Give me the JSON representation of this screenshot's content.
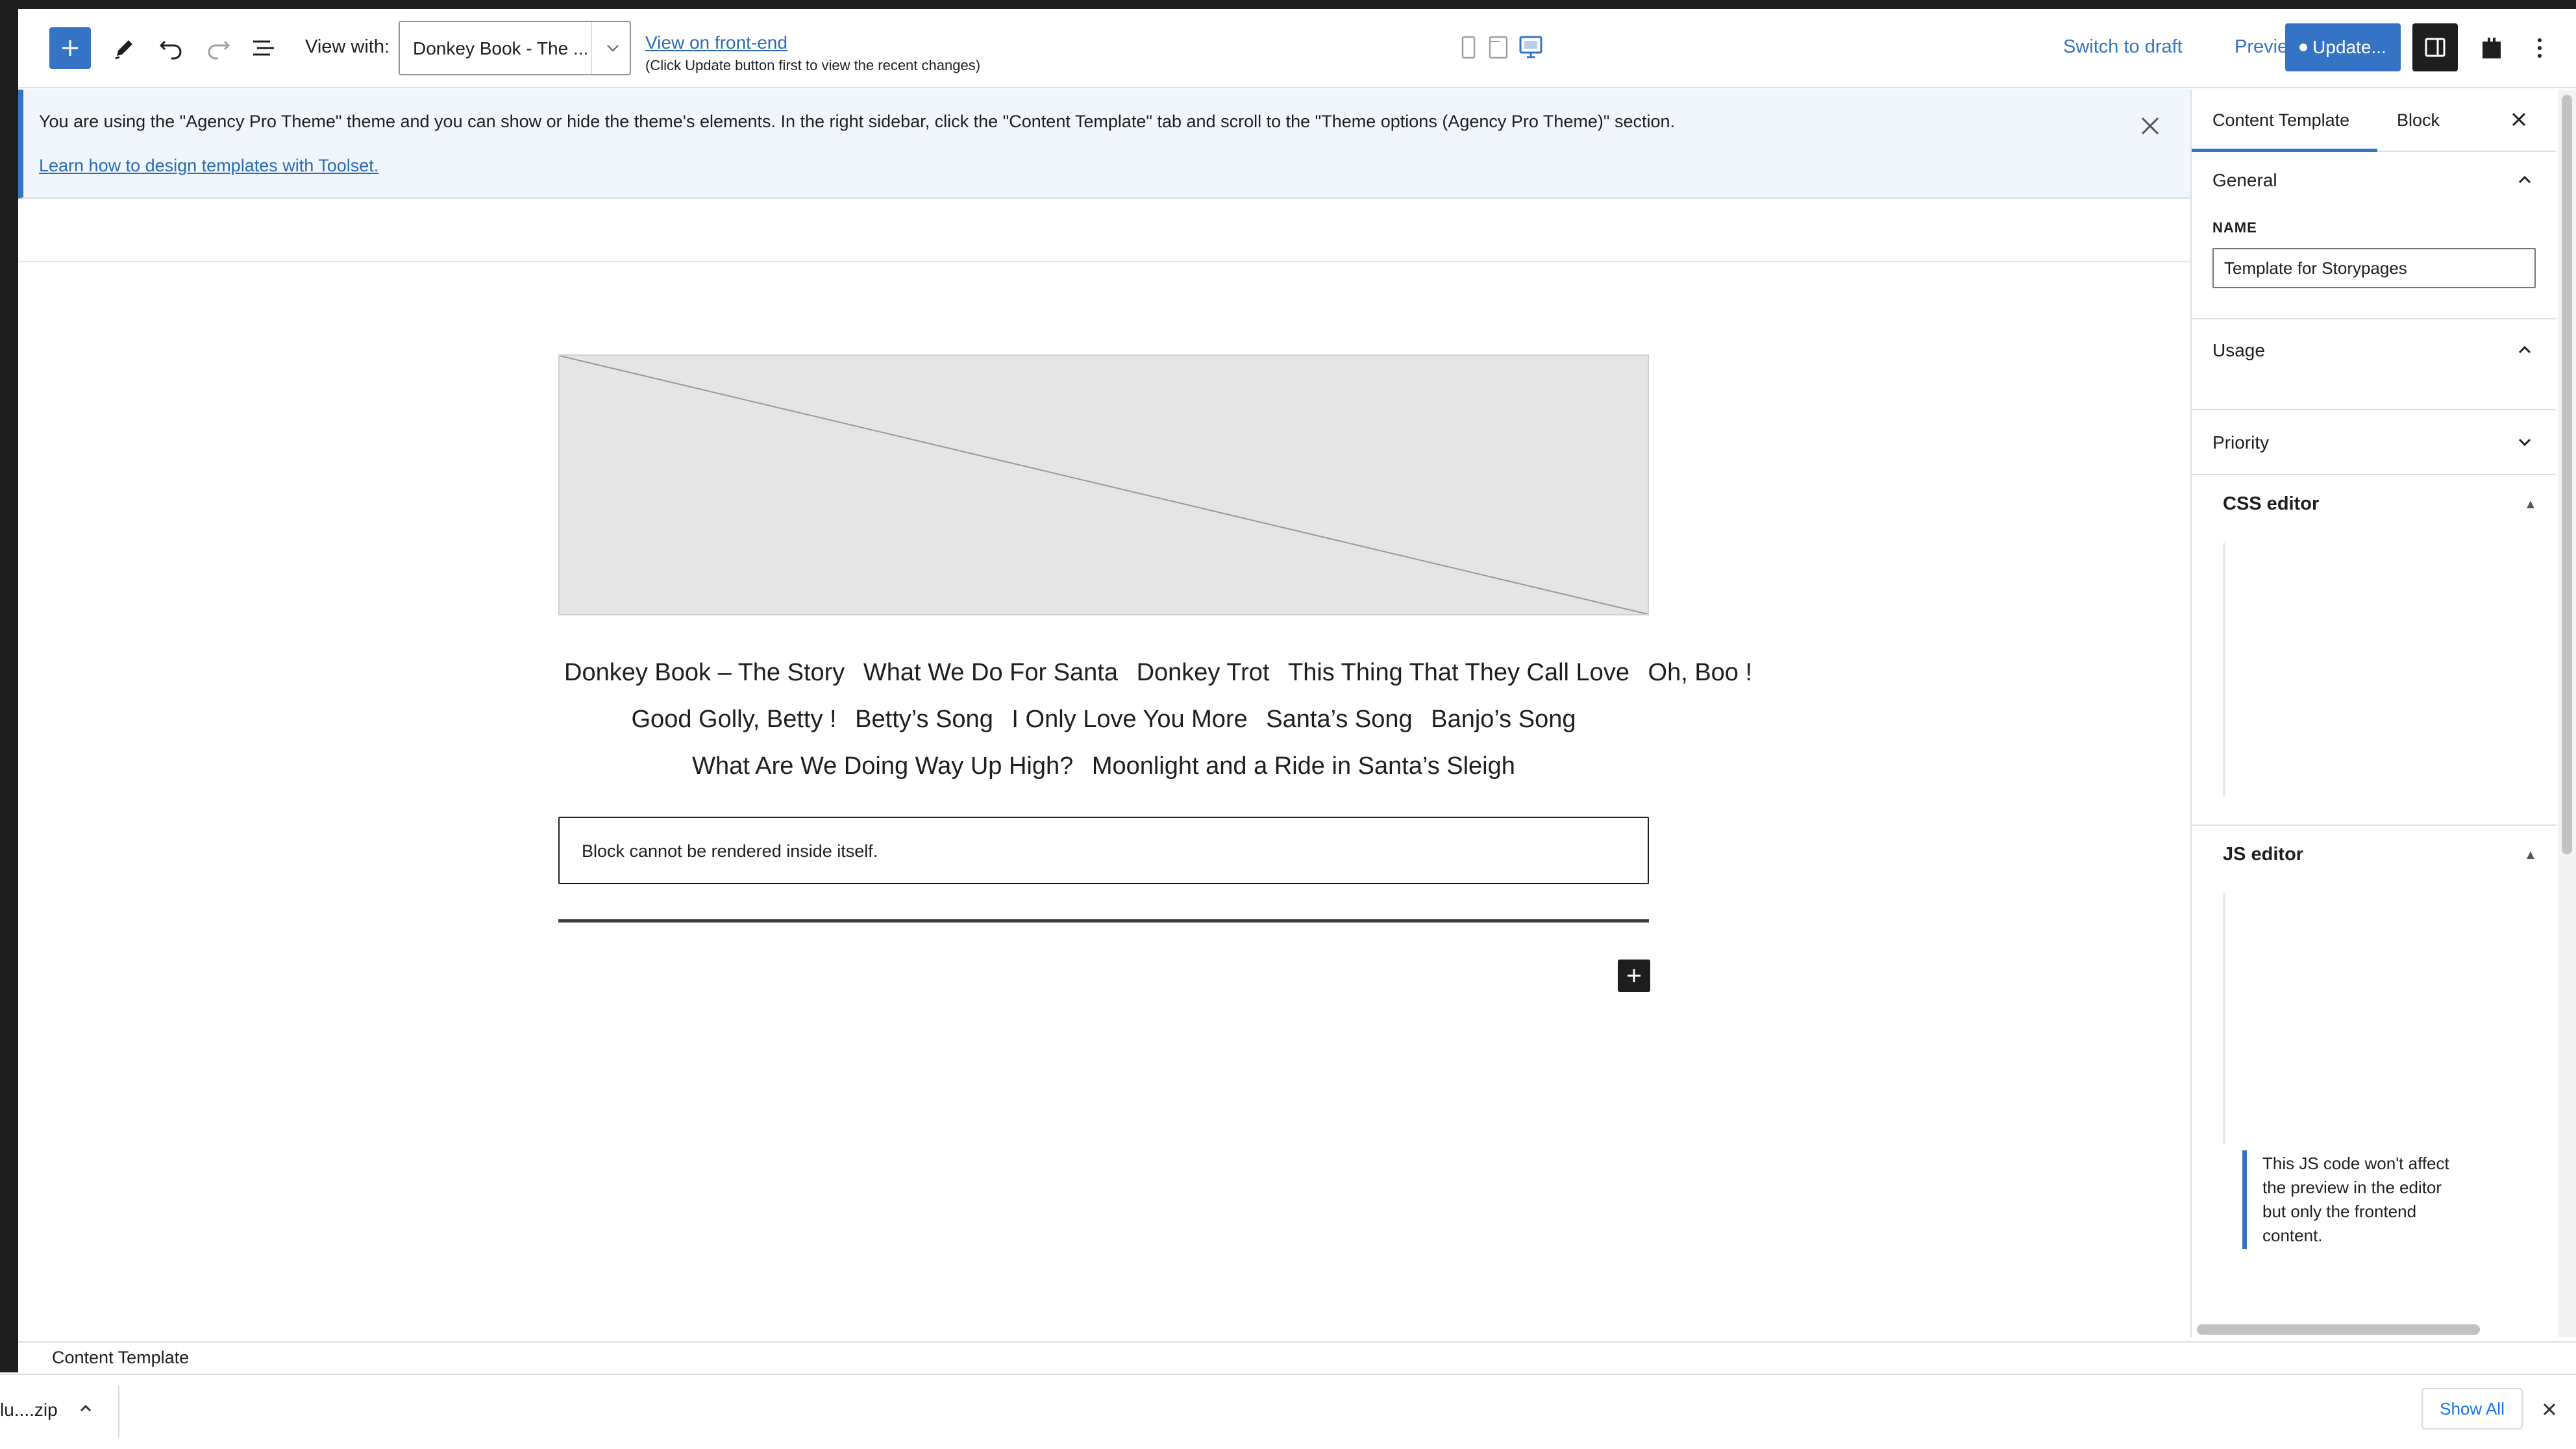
{
  "toolbar": {
    "view_with_label": "View with:",
    "view_with_value": "Donkey Book - The ...",
    "frontend_link": "View on front-end",
    "frontend_note": "(Click Update button first to view the recent changes)",
    "switch_to_draft": "Switch to draft",
    "preview": "Preview",
    "update": "Update..."
  },
  "notice": {
    "text": "You are using the \"Agency Pro Theme\" theme and you can show or hide the theme's elements. In the right sidebar, click the \"Content Template\" tab and scroll to the \"Theme options (Agency Pro Theme)\" section.",
    "link": "Learn how to design templates with Toolset."
  },
  "content": {
    "title_lines": [
      [
        "Donkey Book – The Story",
        "What We Do For Santa",
        "Donkey Trot",
        "This Thing That They Call Love",
        "Oh, Boo !"
      ],
      [
        "Good Golly, Betty !",
        "Betty’s Song",
        "I Only Love You More",
        "Santa’s Song",
        "Banjo’s Song"
      ],
      [
        "What Are We Doing Way Up High?",
        "Moonlight and a Ride in Santa’s Sleigh"
      ]
    ],
    "render_message": "Block cannot be rendered inside itself."
  },
  "sidebar": {
    "tabs": [
      "Content Template",
      "Block"
    ],
    "general": {
      "label": "General",
      "name_label": "NAME",
      "name_value": "Template for Storypages"
    },
    "usage": {
      "label": "Usage"
    },
    "priority": {
      "label": "Priority"
    },
    "css_editor": {
      "label": "CSS editor"
    },
    "js_editor": {
      "label": "JS editor",
      "note": "This JS code won't affect the preview in the editor but only the frontend content."
    }
  },
  "footer": {
    "breadcrumb": "Content Template"
  },
  "downloads": {
    "file": "lu....zip",
    "show_all": "Show All"
  },
  "colors": {
    "accent": "#3573c4",
    "dark": "#1e1e1e",
    "notice_bg": "#f0f6fc"
  }
}
